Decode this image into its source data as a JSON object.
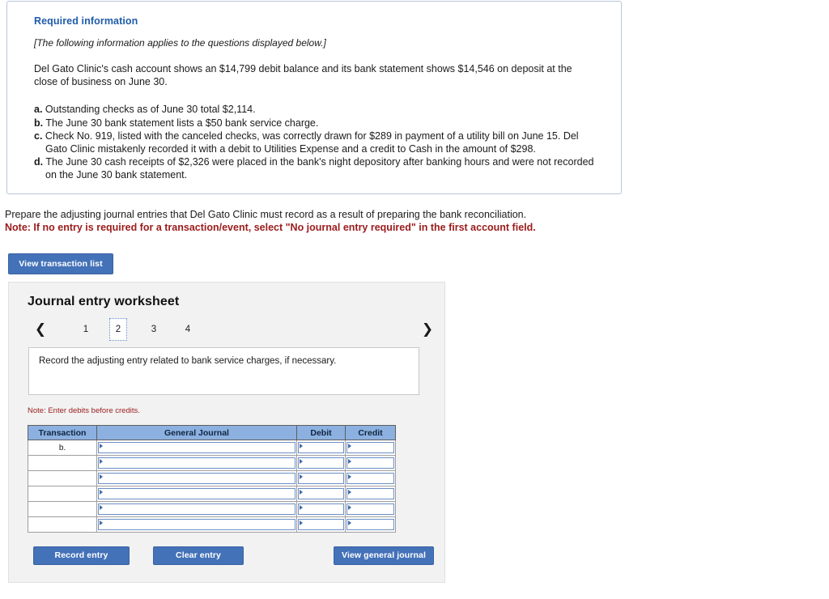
{
  "required_info": {
    "title": "Required information",
    "italic_note": "[The following information applies to the questions displayed below.]",
    "paragraph": "Del Gato Clinic's cash account shows an $14,799 debit balance and its bank statement shows $14,546 on deposit at the close of business on June 30.",
    "items": [
      {
        "lead": "a.",
        "text": "Outstanding checks as of June 30 total $2,114."
      },
      {
        "lead": "b.",
        "text": "The June 30 bank statement lists a $50 bank service charge."
      },
      {
        "lead": "c.",
        "text": "Check No. 919, listed with the canceled checks, was correctly drawn for $289 in payment of a utility bill on June 15. Del Gato Clinic mistakenly recorded it with a debit to Utilities Expense and a credit to Cash in the amount of $298."
      },
      {
        "lead": "d.",
        "text": "The June 30 cash receipts of $2,326 were placed in the bank's night depository after banking hours and were not recorded on the June 30 bank statement."
      }
    ]
  },
  "prompt": {
    "line1": "Prepare the adjusting journal entries that Del Gato Clinic must record as a result of preparing the bank reconciliation.",
    "note": "Note: If no entry is required for a transaction/event, select \"No journal entry required\" in the first account field.",
    "view_transaction_list_label": "View transaction list"
  },
  "worksheet": {
    "title": "Journal entry worksheet",
    "pager": {
      "prev_icon": "chevron-left",
      "next_icon": "chevron-right",
      "pages": [
        "1",
        "2",
        "3",
        "4"
      ],
      "active_page": "2"
    },
    "question": "Record the adjusting entry related to bank service charges, if necessary.",
    "note_debits": "Note: Enter debits before credits.",
    "table": {
      "headers": [
        "Transaction",
        "General Journal",
        "Debit",
        "Credit"
      ],
      "rows": [
        {
          "transaction": "b.",
          "general_journal": "",
          "debit": "",
          "credit": ""
        },
        {
          "transaction": "",
          "general_journal": "",
          "debit": "",
          "credit": ""
        },
        {
          "transaction": "",
          "general_journal": "",
          "debit": "",
          "credit": ""
        },
        {
          "transaction": "",
          "general_journal": "",
          "debit": "",
          "credit": ""
        },
        {
          "transaction": "",
          "general_journal": "",
          "debit": "",
          "credit": ""
        },
        {
          "transaction": "",
          "general_journal": "",
          "debit": "",
          "credit": ""
        }
      ]
    },
    "buttons": {
      "record_entry": "Record entry",
      "clear_entry": "Clear entry",
      "view_general_journal": "View general journal"
    }
  },
  "colors": {
    "button_blue": "#4472b8",
    "table_header_blue": "#8cb0e0",
    "note_red": "#9b1b1b",
    "title_blue": "#1f5ca8",
    "panel_bg": "#f2f2f2"
  }
}
